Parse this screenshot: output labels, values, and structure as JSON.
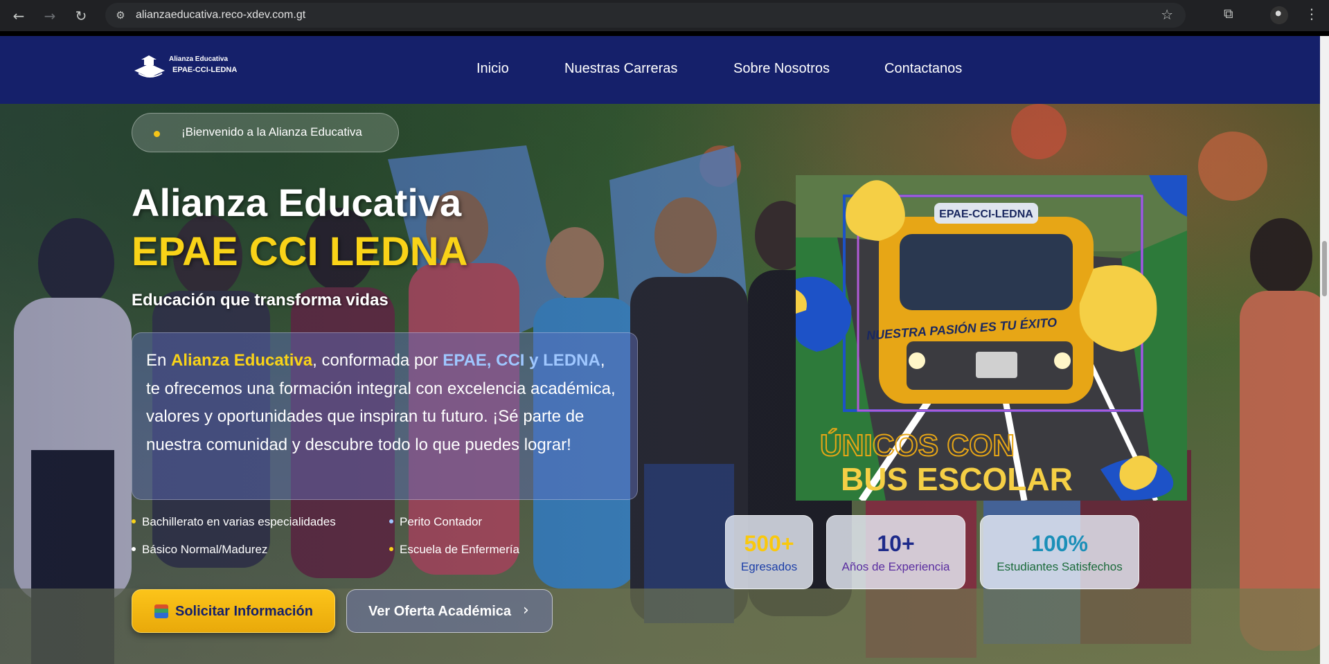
{
  "browser": {
    "url": "alianzaeducativa.reco-xdev.com.gt",
    "icons": [
      "back-arrow-icon",
      "forward-arrow-icon",
      "reload-icon",
      "site-settings-icon",
      "bookmark-star-icon",
      "extensions-icon",
      "profile-avatar",
      "more-menu-icon"
    ]
  },
  "header": {
    "logo_top": "Alianza Educativa",
    "logo_bottom": "EPAE-CCI-LEDNA",
    "nav": [
      "Inicio",
      "Nuestras Carreras",
      "Sobre Nosotros",
      "Contactanos"
    ]
  },
  "hero": {
    "welcome": "¡Bienvenido a la Alianza Educativa",
    "title_line1": "Alianza Educativa",
    "title_line2": "EPAE CCI LEDNA",
    "tagline": "Educación que transforma vidas",
    "intro": {
      "part1": "En ",
      "hl1": "Alianza Educativa",
      "part2": ", conformada por ",
      "hl2": "EPAE, CCI y LEDNA",
      "part3": ", te ofrecemos una formación integral con excelencia académica, valores y oportunidades que inspiran tu futuro. ¡Sé parte de nuestra comunidad y descubre todo lo que puedes lograr!"
    },
    "bullets": [
      {
        "text": "Bachillerato en varias especialidades",
        "color": "#f9d318"
      },
      {
        "text": "Perito Contador",
        "color": "#9fc7ff"
      },
      {
        "text": "Básico Normal/Madurez",
        "color": "#ffffff"
      },
      {
        "text": "Escuela de Enfermería",
        "color": "#f9d318"
      }
    ],
    "btn_primary": "Solicitar Información",
    "btn_secondary": "Ver Oferta Académica"
  },
  "bus_card": {
    "bus_sign": "EPAE-CCI-LEDNA",
    "bus_slogan": "NUESTRA PASIÓN ES TU ÉXITO",
    "line1": "ÚNICOS CON",
    "line2": "BUS ESCOLAR"
  },
  "stats": [
    {
      "value": "500+",
      "label": "Egresados",
      "value_color": "#f9c80e",
      "label_color": "#1d3fa8"
    },
    {
      "value": "10+",
      "label": "Años de Experiencia",
      "value_color": "#1d2a8a",
      "label_color": "#5a2da0"
    },
    {
      "value": "100%",
      "label": "Estudiantes Satisfechos",
      "value_color": "#1a8fb8",
      "label_color": "#1a6a3a"
    }
  ]
}
